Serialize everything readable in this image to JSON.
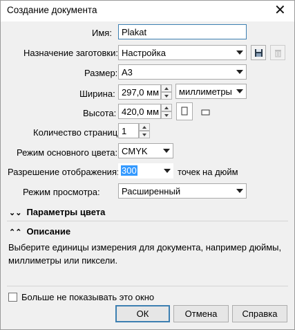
{
  "window": {
    "title": "Создание документа"
  },
  "form": {
    "name": {
      "label": "Имя:",
      "value": "Plakat"
    },
    "preset": {
      "label": "Назначение заготовки:",
      "value": "Настройка"
    },
    "size": {
      "label": "Размер:",
      "value": "А3"
    },
    "width": {
      "label": "Ширина:",
      "value": "297,0 мм",
      "units": "миллиметры"
    },
    "height": {
      "label": "Высота:",
      "value": "420,0 мм"
    },
    "pages": {
      "label": "Количество страниц:",
      "value": "1"
    },
    "color_mode": {
      "label": "Режим основного цвета:",
      "value": "CMYK"
    },
    "resolution": {
      "label": "Разрешение отображения:",
      "value": "300",
      "suffix": "точек на дюйм"
    },
    "preview": {
      "label": "Режим просмотра:",
      "value": "Расширенный"
    }
  },
  "sections": {
    "color_params": "Параметры цвета",
    "description": "Описание"
  },
  "description_text": "Выберите единицы измерения для документа, например дюймы, миллиметры или пиксели.",
  "footer": {
    "dont_show": "Больше не показывать это окно",
    "ok": "ОК",
    "cancel": "Отмена",
    "help": "Справка"
  },
  "icons": {
    "save": "floppy-disk-icon",
    "delete": "trash-icon",
    "portrait": "portrait-page-icon",
    "landscape": "landscape-page-icon"
  },
  "colors": {
    "accent": "#3c7fb1",
    "selection": "#3399ff"
  }
}
